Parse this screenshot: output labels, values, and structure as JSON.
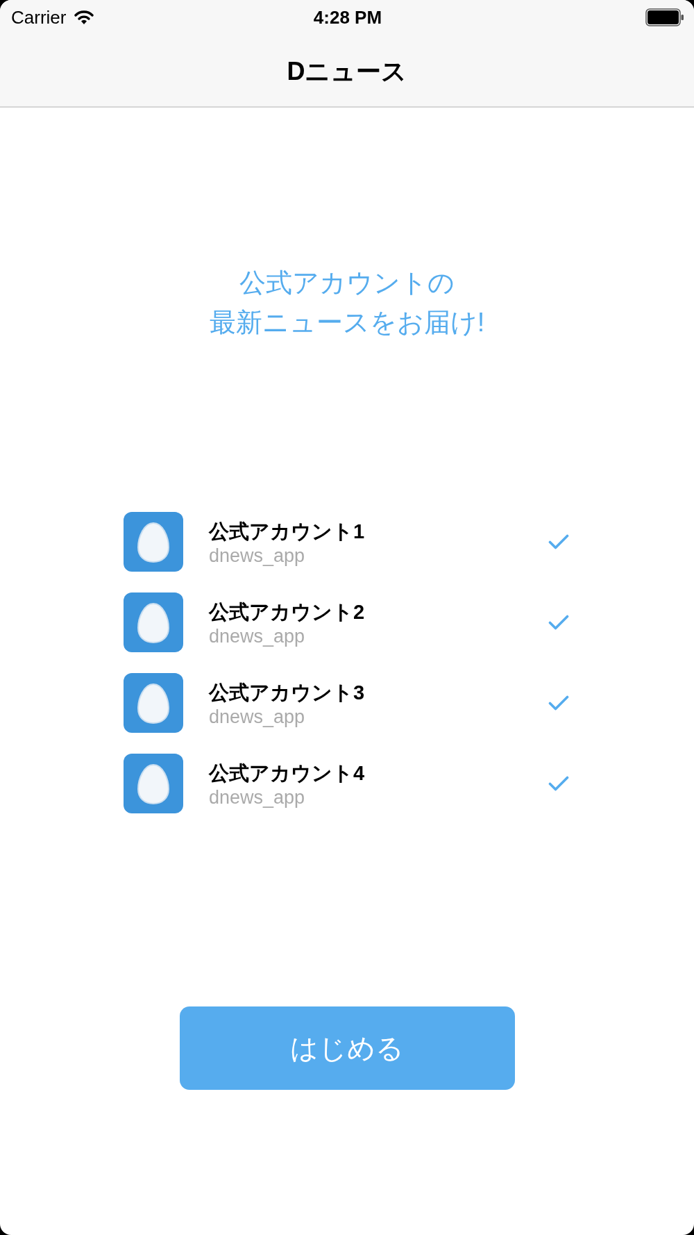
{
  "status_bar": {
    "carrier": "Carrier",
    "time": "4:28 PM"
  },
  "nav_bar": {
    "title": "Dニュース"
  },
  "headline": [
    "公式アカウントの",
    "最新ニュースをお届け!"
  ],
  "accounts": [
    {
      "name": "公式アカウント1",
      "handle": "dnews_app",
      "checked": true
    },
    {
      "name": "公式アカウント2",
      "handle": "dnews_app",
      "checked": true
    },
    {
      "name": "公式アカウント3",
      "handle": "dnews_app",
      "checked": true
    },
    {
      "name": "公式アカウント4",
      "handle": "dnews_app",
      "checked": true
    }
  ],
  "start_button": {
    "label": "はじめる"
  }
}
